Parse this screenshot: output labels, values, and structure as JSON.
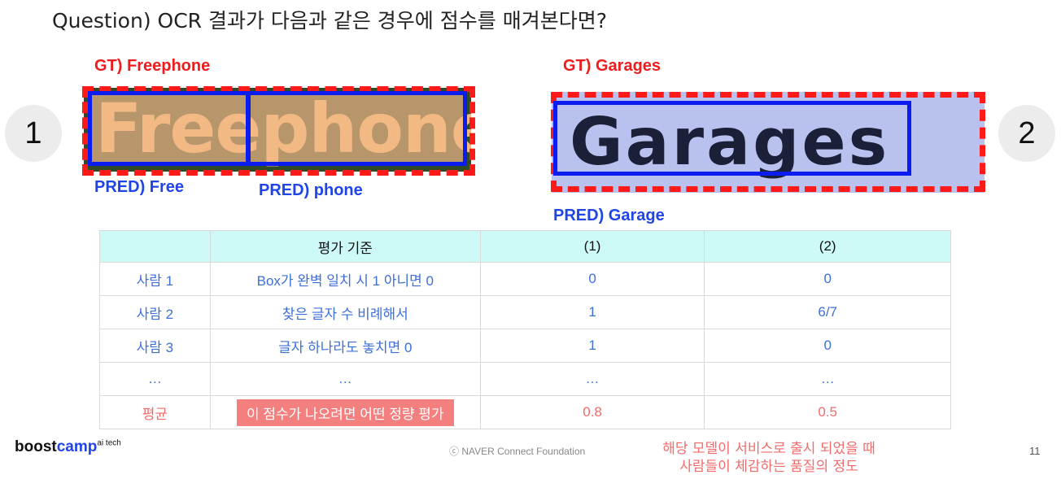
{
  "title": "Question) OCR 결과가 다음과 같은 경우에 점수를 매겨본다면?",
  "example1": {
    "number": "1",
    "gt": "GT) Freephone",
    "word": "Freephone",
    "pred1": "PRED) Free",
    "pred2": "PRED) phone"
  },
  "example2": {
    "number": "2",
    "gt": "GT) Garages",
    "word": "Garages",
    "pred": "PRED) Garage"
  },
  "table": {
    "headers": [
      "",
      "평가 기준",
      "(1)",
      "(2)"
    ],
    "rows": [
      [
        "사람 1",
        "Box가 완벽 일치 시 1 아니면 0",
        "0",
        "0"
      ],
      [
        "사람 2",
        "찾은 글자 수 비례해서",
        "1",
        "6/7"
      ],
      [
        "사람 3",
        "글자 하나라도 놓치면 0",
        "1",
        "0"
      ],
      [
        "…",
        "…",
        "…",
        "…"
      ]
    ],
    "average": [
      "평균",
      "이 점수가 나오려면 어떤 정량 평가",
      "0.8",
      "0.5"
    ]
  },
  "colors": {
    "gt_red": "#ee1c1c",
    "pred_blue": "#1f44e8",
    "header_bg": "#cdfaf7",
    "highlight": "#f37f7f"
  },
  "footer": {
    "logo_main": "boost",
    "logo_accent": "camp",
    "logo_sup": "ai tech",
    "copyright": "ⓒ NAVER Connect Foundation",
    "note_line1": "해당 모델이 서비스로 출시 되었을 때",
    "note_line2": "사람들이 체감하는 품질의 정도",
    "page": "11"
  }
}
